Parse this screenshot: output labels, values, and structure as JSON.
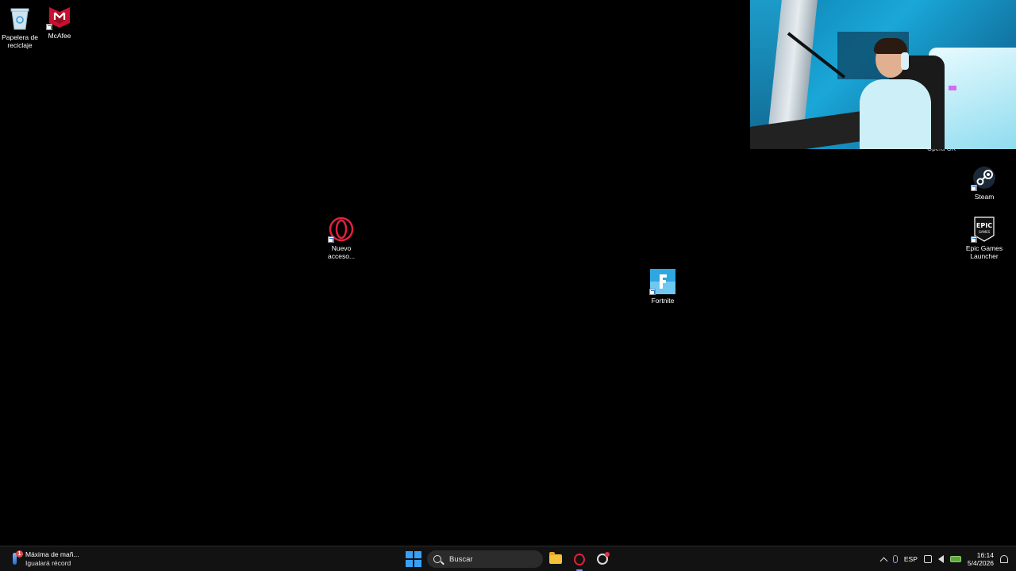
{
  "desktop": {
    "icons": [
      {
        "label": "Papelera de\nreciclaje",
        "icon": "recycle-bin-icon"
      },
      {
        "label": "McAfee",
        "icon": "mcafee-icon"
      },
      {
        "label": "Nuevo\nacceso...",
        "icon": "opera-icon"
      },
      {
        "label": "Fortnite",
        "icon": "fortnite-icon"
      },
      {
        "label": "Steam",
        "icon": "steam-icon"
      },
      {
        "label": "Epic Games\nLauncher",
        "icon": "epic-games-icon"
      }
    ],
    "cutoff_label": "Opera GX"
  },
  "taskbar": {
    "widget": {
      "title": "Máxima de mañ...",
      "subtitle": "Igualará récord",
      "badge": "1"
    },
    "search": {
      "placeholder": "Buscar"
    },
    "tray": {
      "language": "ESP",
      "time": "16:14",
      "date": "5/4/2026"
    }
  },
  "colors": {
    "taskbar": "#121212",
    "accent": "#3aa0f3",
    "opera_red": "#e0213f"
  }
}
